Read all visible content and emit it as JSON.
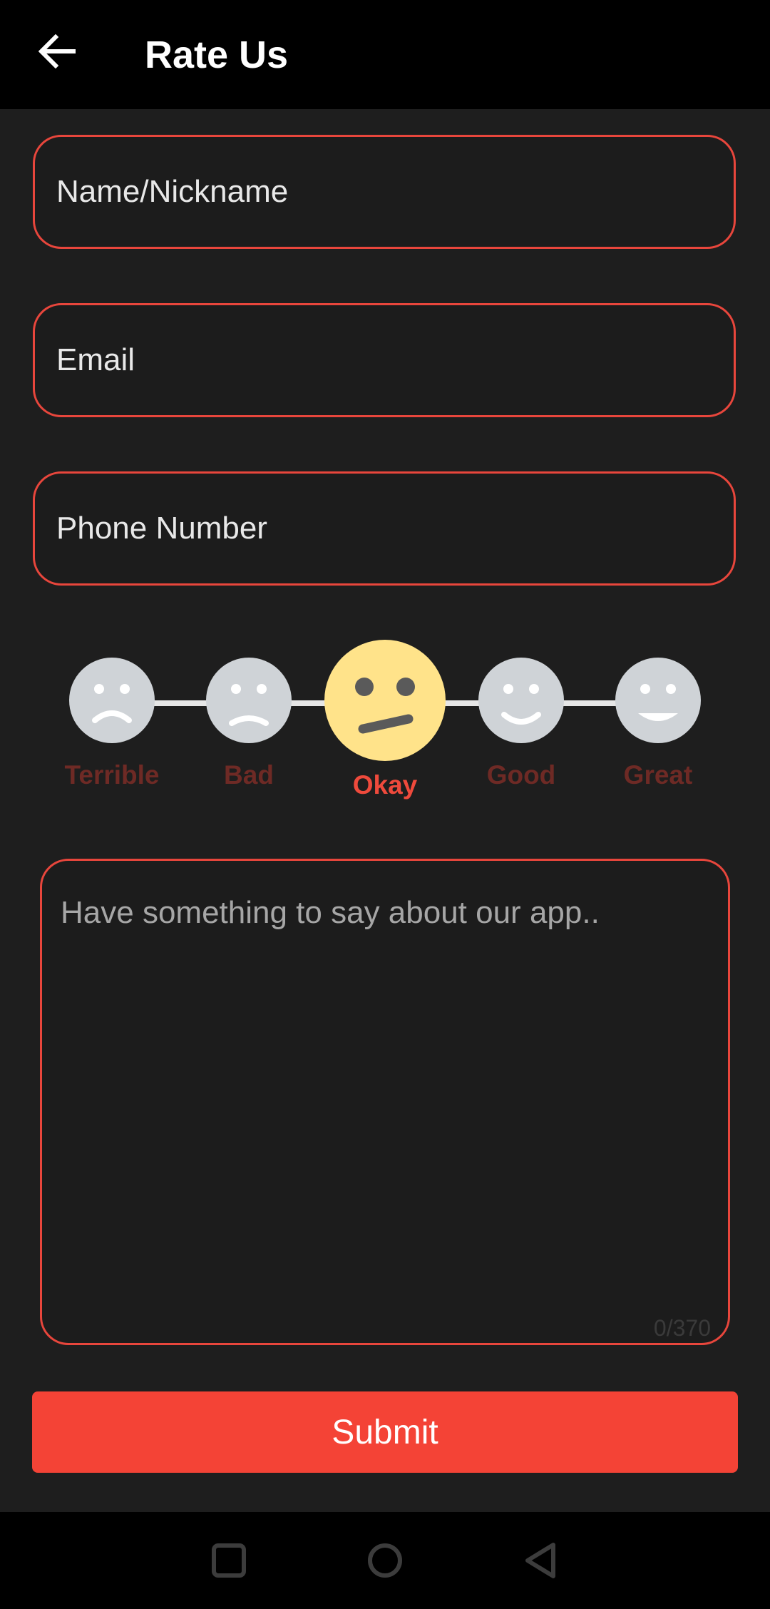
{
  "app_bar": {
    "title": "Rate Us",
    "back_icon": "arrow-left-icon"
  },
  "form": {
    "name_placeholder": "Name/Nickname",
    "email_placeholder": "Email",
    "phone_placeholder": "Phone Number"
  },
  "rating": {
    "options": [
      "Terrible",
      "Bad",
      "Okay",
      "Good",
      "Great"
    ],
    "selected": "Okay",
    "selected_index": 2
  },
  "comment": {
    "placeholder": "Have something to say about our app..",
    "counter": "0/370"
  },
  "submit": {
    "label": "Submit"
  },
  "colors": {
    "accent": "#f44336",
    "selected_face": "#ffe38a",
    "inactive_face": "#cfd3d7",
    "inactive_label": "#6e2a25"
  },
  "system_nav": {
    "icons": [
      "square-icon",
      "circle-icon",
      "triangle-back-icon"
    ]
  }
}
